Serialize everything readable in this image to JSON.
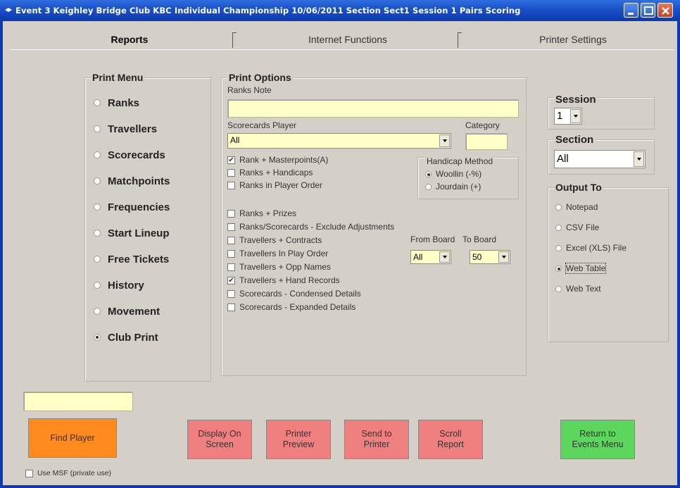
{
  "window": {
    "title": "Event 3  Keighley Bridge Club KBC Individual Championship 10/06/2011 Section Sect1 Session 1 Pairs Scoring"
  },
  "tabs": [
    "Reports",
    "Internet Functions",
    "Printer Settings"
  ],
  "print_menu": {
    "title": "Print Menu",
    "items": [
      {
        "label": "Ranks",
        "checked": false
      },
      {
        "label": "Travellers",
        "checked": false
      },
      {
        "label": "Scorecards",
        "checked": false
      },
      {
        "label": "Matchpoints",
        "checked": false
      },
      {
        "label": "Frequencies",
        "checked": false
      },
      {
        "label": "Start Lineup",
        "checked": false
      },
      {
        "label": "Free Tickets",
        "checked": false
      },
      {
        "label": "History",
        "checked": false
      },
      {
        "label": "Movement",
        "checked": false
      },
      {
        "label": "Club Print",
        "checked": true
      }
    ]
  },
  "print_options": {
    "title": "Print Options",
    "ranks_note_label": "Ranks Note",
    "ranks_note_value": "",
    "scorecards_player_label": "Scorecards Player",
    "scorecards_player_value": "All",
    "category_label": "Category",
    "category_value": "",
    "checkboxes_top": [
      {
        "label": "Rank + Masterpoints(A)",
        "checked": true
      },
      {
        "label": "Ranks + Handicaps",
        "checked": false
      },
      {
        "label": "Ranks in Player Order",
        "checked": false
      }
    ],
    "handicap": {
      "title": "Handicap Method",
      "options": [
        {
          "label": "Woollin (-%)",
          "checked": true
        },
        {
          "label": "Jourdain (+)",
          "checked": false
        }
      ]
    },
    "checkboxes_bottom": [
      {
        "label": "Ranks + Prizes",
        "checked": false
      },
      {
        "label": "Ranks/Scorecards - Exclude Adjustments",
        "checked": false
      },
      {
        "label": "Travellers + Contracts",
        "checked": false
      },
      {
        "label": "Travellers In Play Order",
        "checked": false
      },
      {
        "label": "Travellers + Opp Names",
        "checked": false
      },
      {
        "label": "Travellers + Hand Records",
        "checked": true
      },
      {
        "label": "Scorecards - Condensed  Details",
        "checked": false
      },
      {
        "label": "Scorecards - Expanded Details",
        "checked": false
      }
    ],
    "from_board_label": "From Board",
    "to_board_label": "To Board",
    "from_board_value": "All",
    "to_board_value": "50"
  },
  "session": {
    "label": "Session",
    "value": "1"
  },
  "section": {
    "label": "Section",
    "value": "All"
  },
  "output_to": {
    "title": "Output To",
    "options": [
      {
        "label": "Notepad",
        "checked": false
      },
      {
        "label": "CSV File",
        "checked": false
      },
      {
        "label": "Excel (XLS) File",
        "checked": false
      },
      {
        "label": "Web Table",
        "checked": true
      },
      {
        "label": "Web Text",
        "checked": false
      }
    ]
  },
  "player_search_value": "",
  "buttons": {
    "find_player": "Find Player",
    "display_on_screen": "Display On\nScreen",
    "printer_preview": "Printer\nPreview",
    "send_to_printer": "Send to\nPrinter",
    "scroll_report": "Scroll\nReport",
    "return_to_events": "Return to\nEvents Menu"
  },
  "use_msf": {
    "label": "Use MSF (private use)",
    "checked": false
  },
  "colors": {
    "title_bar": "#1b52c8",
    "input_yellow": "#ffffc6",
    "button_red": "#f08080",
    "button_orange": "#ff8a1e",
    "button_green": "#5cd65c"
  }
}
